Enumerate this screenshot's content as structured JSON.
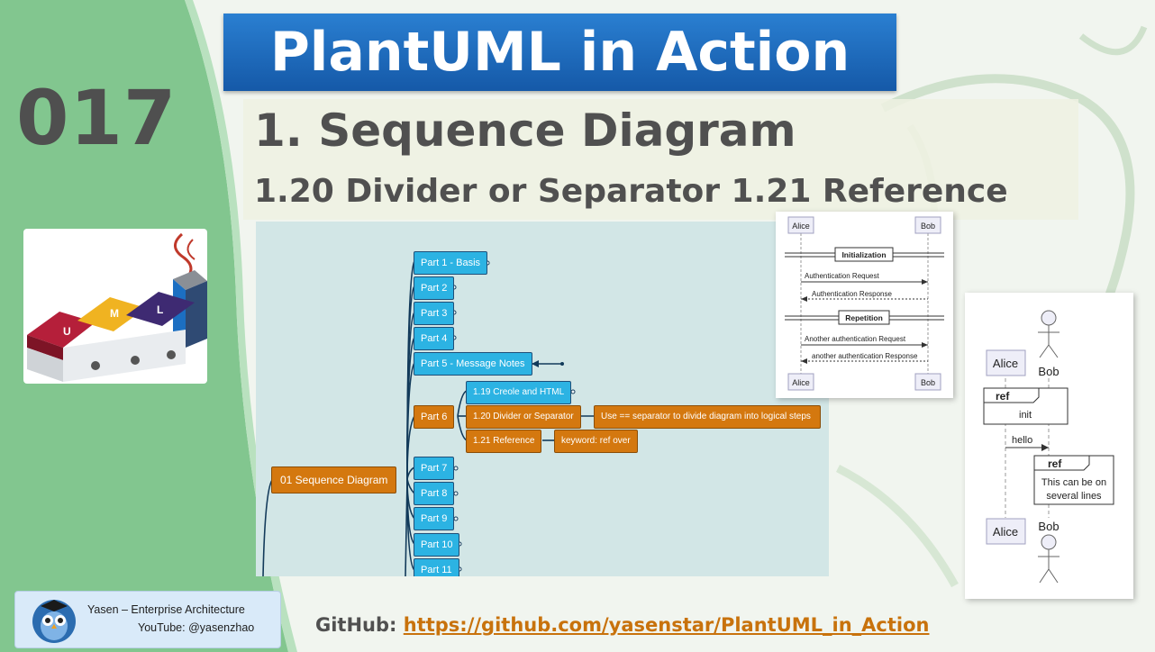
{
  "episode": "017",
  "title": "PlantUML in Action",
  "section_title": "1. Sequence Diagram",
  "section_subtitle": "1.20 Divider or Separator 1.21 Reference",
  "mindmap": {
    "root": "01 Sequence Diagram",
    "parts": [
      "Part 1 - Basis",
      "Part 2",
      "Part 3",
      "Part 4",
      "Part 5 - Message Notes",
      "Part 6",
      "Part 7",
      "Part 8",
      "Part 9",
      "Part 10",
      "Part 11"
    ],
    "part6_children": [
      "1.19 Creole and HTML",
      "1.20 Divider or Separator",
      "1.21 Reference"
    ],
    "divider_note": "Use == separator to divide diagram into logical steps",
    "reference_note": "keyword: ref over"
  },
  "seq_divider": {
    "participants": [
      "Alice",
      "Bob"
    ],
    "dividers": [
      "Initialization",
      "Repetition"
    ],
    "messages": [
      "Authentication Request",
      "Authentication Response",
      "Another authentication Request",
      "another authentication Response"
    ]
  },
  "seq_reference": {
    "participants": [
      "Alice",
      "Bob"
    ],
    "ref_keyword": "ref",
    "ref1_text": "init",
    "message": "hello",
    "ref2_line1": "This can be on",
    "ref2_line2": "several lines"
  },
  "author": {
    "name": "Yasen – Enterprise Architecture",
    "youtube": "YouTube: @yasenzhao"
  },
  "github": {
    "label": "GitHub:",
    "url": "https://github.com/yasenstar/PlantUML_in_Action"
  },
  "colors": {
    "title_bar": "#1b6cc0",
    "green_arc": "#7ec28a",
    "mindmap_blue": "#2cb3e3",
    "mindmap_orange": "#d4780f",
    "link": "#c8720c"
  }
}
